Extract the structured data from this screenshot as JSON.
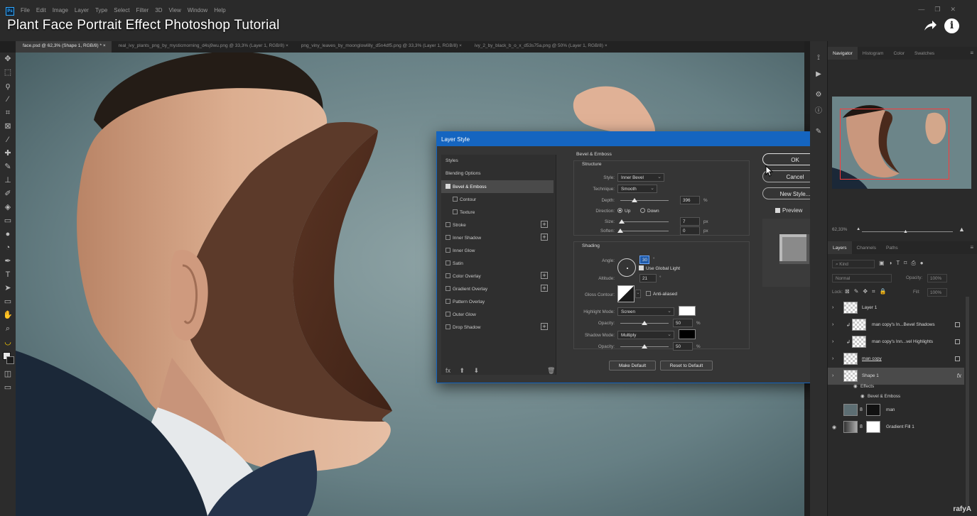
{
  "app": {
    "menu": [
      "File",
      "Edit",
      "Image",
      "Layer",
      "Type",
      "Select",
      "Filter",
      "3D",
      "View",
      "Window",
      "Help"
    ],
    "video_title": "Plant Face Portrait Effect Photoshop Tutorial",
    "watermark": "rafyA"
  },
  "doc_tabs": [
    {
      "label": "face.psd @ 62,3% (Shape 1, RGB/8) *",
      "active": true
    },
    {
      "label": "real_ivy_plants_png_by_mysticmorning_d4sj9wu.png @ 33,3% (Layer 1, RGB/8)",
      "active": false
    },
    {
      "label": "png_viny_leaves_by_moonglowlilly_d5n4df5.png @ 33,3% (Layer 1, RGB/8)",
      "active": false
    },
    {
      "label": "ivy_2_by_black_b_o_x_d53s75a.png @ 50% (Layer 1, RGB/8)",
      "active": false
    }
  ],
  "dialog": {
    "title": "Layer Style",
    "styles": [
      {
        "label": "Styles",
        "checkbox": false,
        "checked": false,
        "plus": false,
        "selected": false,
        "sub": false
      },
      {
        "label": "Blending Options",
        "checkbox": false,
        "checked": false,
        "plus": false,
        "selected": false,
        "sub": false
      },
      {
        "label": "Bevel & Emboss",
        "checkbox": true,
        "checked": true,
        "plus": false,
        "selected": true,
        "sub": false
      },
      {
        "label": "Contour",
        "checkbox": true,
        "checked": false,
        "plus": false,
        "selected": false,
        "sub": true
      },
      {
        "label": "Texture",
        "checkbox": true,
        "checked": false,
        "plus": false,
        "selected": false,
        "sub": true
      },
      {
        "label": "Stroke",
        "checkbox": true,
        "checked": false,
        "plus": true,
        "selected": false,
        "sub": false
      },
      {
        "label": "Inner Shadow",
        "checkbox": true,
        "checked": false,
        "plus": true,
        "selected": false,
        "sub": false
      },
      {
        "label": "Inner Glow",
        "checkbox": true,
        "checked": false,
        "plus": false,
        "selected": false,
        "sub": false
      },
      {
        "label": "Satin",
        "checkbox": true,
        "checked": false,
        "plus": false,
        "selected": false,
        "sub": false
      },
      {
        "label": "Color Overlay",
        "checkbox": true,
        "checked": false,
        "plus": true,
        "selected": false,
        "sub": false
      },
      {
        "label": "Gradient Overlay",
        "checkbox": true,
        "checked": false,
        "plus": true,
        "selected": false,
        "sub": false
      },
      {
        "label": "Pattern Overlay",
        "checkbox": true,
        "checked": false,
        "plus": false,
        "selected": false,
        "sub": false
      },
      {
        "label": "Outer Glow",
        "checkbox": true,
        "checked": false,
        "plus": false,
        "selected": false,
        "sub": false
      },
      {
        "label": "Drop Shadow",
        "checkbox": true,
        "checked": false,
        "plus": true,
        "selected": false,
        "sub": false
      }
    ],
    "fx_label": "fx",
    "section_title": "Bevel & Emboss",
    "structure": {
      "title": "Structure",
      "style_label": "Style:",
      "style_value": "Inner Bevel",
      "technique_label": "Technique:",
      "technique_value": "Smooth",
      "depth_label": "Depth:",
      "depth_value": "396",
      "depth_unit": "%",
      "direction_label": "Direction:",
      "direction_up": "Up",
      "direction_down": "Down",
      "size_label": "Size:",
      "size_value": "7",
      "size_unit": "px",
      "soften_label": "Soften:",
      "soften_value": "0",
      "soften_unit": "px"
    },
    "shading": {
      "title": "Shading",
      "angle_label": "Angle:",
      "angle_value": "30",
      "angle_unit": "°",
      "global_light_label": "Use Global Light",
      "altitude_label": "Altitude:",
      "altitude_value": "21",
      "altitude_unit": "°",
      "gloss_label": "Gloss Contour:",
      "anti_aliased_label": "Anti-aliased",
      "highlight_label": "Highlight Mode:",
      "highlight_value": "Screen",
      "highlight_opacity_label": "Opacity:",
      "highlight_opacity": "50",
      "highlight_opacity_unit": "%",
      "shadow_label": "Shadow Mode:",
      "shadow_value": "Multiply",
      "shadow_opacity_label": "Opacity:",
      "shadow_opacity": "50",
      "shadow_opacity_unit": "%"
    },
    "make_default": "Make Default",
    "reset_default": "Reset to Default",
    "ok": "OK",
    "cancel": "Cancel",
    "new_style": "New Style...",
    "preview": "Preview"
  },
  "panels": {
    "nav_tabs": [
      "Navigator",
      "Histogram",
      "Color",
      "Swatches"
    ],
    "zoom": "62,33%",
    "layer_tabs": [
      "Layers",
      "Channels",
      "Paths"
    ],
    "kind_label": "Kind",
    "blend_mode": "Normal",
    "opacity_label": "Opacity:",
    "opacity_value": "100%",
    "lock_label": "Lock:",
    "fill_label": "Fill:",
    "fill_value": "100%",
    "layers": [
      {
        "name": "Layer 1"
      },
      {
        "name": "man copy's In...Bevel Shadows"
      },
      {
        "name": "man copy's Inn...vel Highlights"
      },
      {
        "name": "man copy"
      },
      {
        "name": "Shape 1"
      },
      {
        "name": "man"
      },
      {
        "name": "Gradient Fill 1"
      }
    ],
    "effects_label": "Effects",
    "effect_item": "Bevel & Emboss"
  }
}
